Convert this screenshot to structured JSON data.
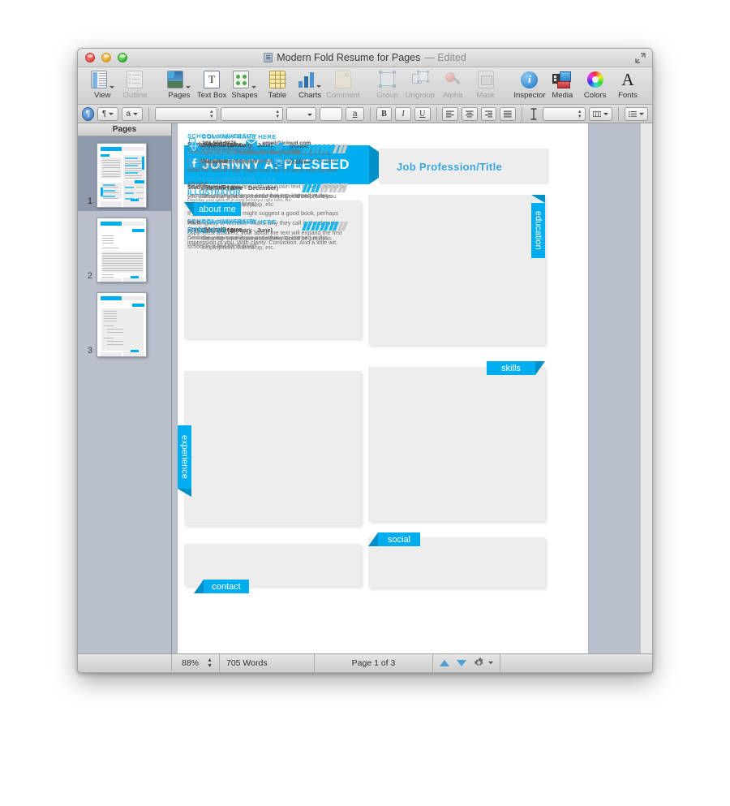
{
  "window": {
    "title": "Modern Fold Resume for Pages",
    "title_suffix": "— Edited",
    "proxy_icon": "document-icon",
    "fullscreen_icon": "fullscreen-arrows-icon"
  },
  "toolbar": {
    "items": [
      {
        "label": "View",
        "icon": "view-icon",
        "enabled": true,
        "has_menu": true
      },
      {
        "label": "Outline",
        "icon": "outline-icon",
        "enabled": false,
        "has_menu": false
      },
      {
        "label": "Pages",
        "icon": "pages-icon",
        "enabled": true,
        "has_menu": true
      },
      {
        "label": "Text Box",
        "icon": "textbox-icon",
        "enabled": true,
        "has_menu": false
      },
      {
        "label": "Shapes",
        "icon": "shapes-icon",
        "enabled": true,
        "has_menu": true
      },
      {
        "label": "Table",
        "icon": "table-icon",
        "enabled": true,
        "has_menu": false
      },
      {
        "label": "Charts",
        "icon": "charts-icon",
        "enabled": true,
        "has_menu": true
      },
      {
        "label": "Comment",
        "icon": "comment-icon",
        "enabled": false,
        "has_menu": false
      },
      {
        "label": "Group",
        "icon": "group-icon",
        "enabled": false,
        "has_menu": false
      },
      {
        "label": "Ungroup",
        "icon": "ungroup-icon",
        "enabled": false,
        "has_menu": false
      },
      {
        "label": "Alpha",
        "icon": "alpha-icon",
        "enabled": false,
        "has_menu": false
      },
      {
        "label": "Mask",
        "icon": "mask-icon",
        "enabled": false,
        "has_menu": false
      },
      {
        "label": "Inspector",
        "icon": "inspector-icon",
        "enabled": true,
        "has_menu": false
      },
      {
        "label": "Media",
        "icon": "media-icon",
        "enabled": true,
        "has_menu": false
      },
      {
        "label": "Colors",
        "icon": "colors-icon",
        "enabled": true,
        "has_menu": false
      },
      {
        "label": "Fonts",
        "icon": "fonts-icon",
        "enabled": true,
        "has_menu": false
      }
    ]
  },
  "format_bar": {
    "style_drawer_icon": "paragraph-drawer-icon",
    "paragraph_style": "¶",
    "character_style": "a",
    "font_family": "",
    "font_typeface": "",
    "font_size": "",
    "text_color_label": "a",
    "bold_label": "B",
    "italic_label": "I",
    "underline_label": "U",
    "align_icons": [
      "align-left-icon",
      "align-center-icon",
      "align-right-icon",
      "align-justify-icon"
    ],
    "line_spacing_icon": "line-spacing-icon",
    "line_spacing_value": "",
    "columns_icon": "columns-icon",
    "list_icon": "list-icon"
  },
  "sidebar": {
    "header": "Pages",
    "thumbnails": [
      {
        "number": "1",
        "selected": true
      },
      {
        "number": "2",
        "selected": false
      },
      {
        "number": "3",
        "selected": false
      }
    ]
  },
  "status_bar": {
    "zoom": "88%",
    "zoom_stepper_icon": "stepper-icon",
    "word_count": "705 Words",
    "page_indicator": "Page 1 of 3",
    "prev_page_icon": "arrow-up-icon",
    "next_page_icon": "arrow-down-icon",
    "settings_icon": "gear-icon"
  },
  "colors": {
    "accent": "#00AEEF",
    "accent_dark": "#0090c8",
    "panel": "#ededed",
    "heading_blue": "#29ade4"
  },
  "resume": {
    "name": "JOHNNY APPLESEED",
    "job_title": "Job Profession/Title",
    "about": {
      "tab": "about me",
      "paragraphs": [
        "This is some dummy copy. You're not really supposed to read this dummy copy, it is just a place holder to visualize what the actual copy might look like if it were real content.",
        "You can replace this text with your own text to describe who you are and why your potential employer should hire you.",
        "If you want to read, I might suggest a good book, perhaps Hemingway or Melville. That's why they call it, the dummy copy. Rest assured, your about me text will expand the first impression of you. With clarity. Conviction. And a little wit."
      ]
    },
    "education": {
      "tab": "education",
      "entries": [
        {
          "school": "SCHOOL UNIVERSITY",
          "degree": "Study/Major/Degree",
          "description": "Describe your experience and what you learned at this school in a few short lines."
        },
        {
          "school": "SCHOOL UNIVERSITY",
          "degree": "Study/Major/Degree",
          "description": "Describe your experience and what you learned at this school in a few short lines."
        },
        {
          "school": "SCHOOL UNIVERSITY",
          "degree": "Study/Major/Degree",
          "description": "Describe your experience and what you learned at this school in a few short lines."
        }
      ]
    },
    "experience": {
      "tab": "experience",
      "entries": [
        {
          "company": "COMPANY NAME HERE",
          "job_title": "Job Title (January - June)",
          "description": "Describe your experience here. Could be previous employment, internship, etc."
        },
        {
          "company": "COMPANY NAME HERE",
          "job_title": "Job Title (June - December)",
          "description": "Describe your experience here. Could be previous employment, internship, etc."
        },
        {
          "company": "COMPANY NAME HERE",
          "job_title": "Job Title (January - June)",
          "description": "Describe your experience here. Could be previous employment, internship, etc."
        }
      ]
    },
    "skills": {
      "tab": "skills",
      "entries": [
        {
          "category": "ADOBE",
          "name": "PHOTOSHOP",
          "description": "Describe your skills in a short sentence right here. Be convincing, it's not the tools, it's you!",
          "filled": 7,
          "total": 10
        },
        {
          "category": "ADOBE",
          "name": "ILLUSTRATOR",
          "description": "Describe your skills in a short sentence right here. Be convincing, it's not the tools, it's you!",
          "filled": 4,
          "total": 10
        },
        {
          "category": "WEB",
          "name": "HTML/CSS",
          "description": "Describe your skills in a short sentence right here. Be convincing, it's not the tools, it's you!",
          "filled": 8,
          "total": 10
        }
      ]
    },
    "contact": {
      "tab": "contact",
      "entries": [
        {
          "icon": "phone-icon",
          "text": "123-555-9876"
        },
        {
          "icon": "envelope-icon",
          "text": "email@icloud.com"
        }
      ]
    },
    "social": {
      "tab": "social",
      "entries": [
        {
          "icon": "globe-icon",
          "text": "mypersonalsite.com",
          "underlined": true
        },
        {
          "icon": "twitter-icon",
          "text": "@twitter",
          "underlined": false
        },
        {
          "icon": "facebook-icon",
          "text": "/facebook",
          "underlined": true
        },
        {
          "icon": "youtube-icon",
          "text": "/youtube",
          "underlined": false
        }
      ]
    }
  }
}
